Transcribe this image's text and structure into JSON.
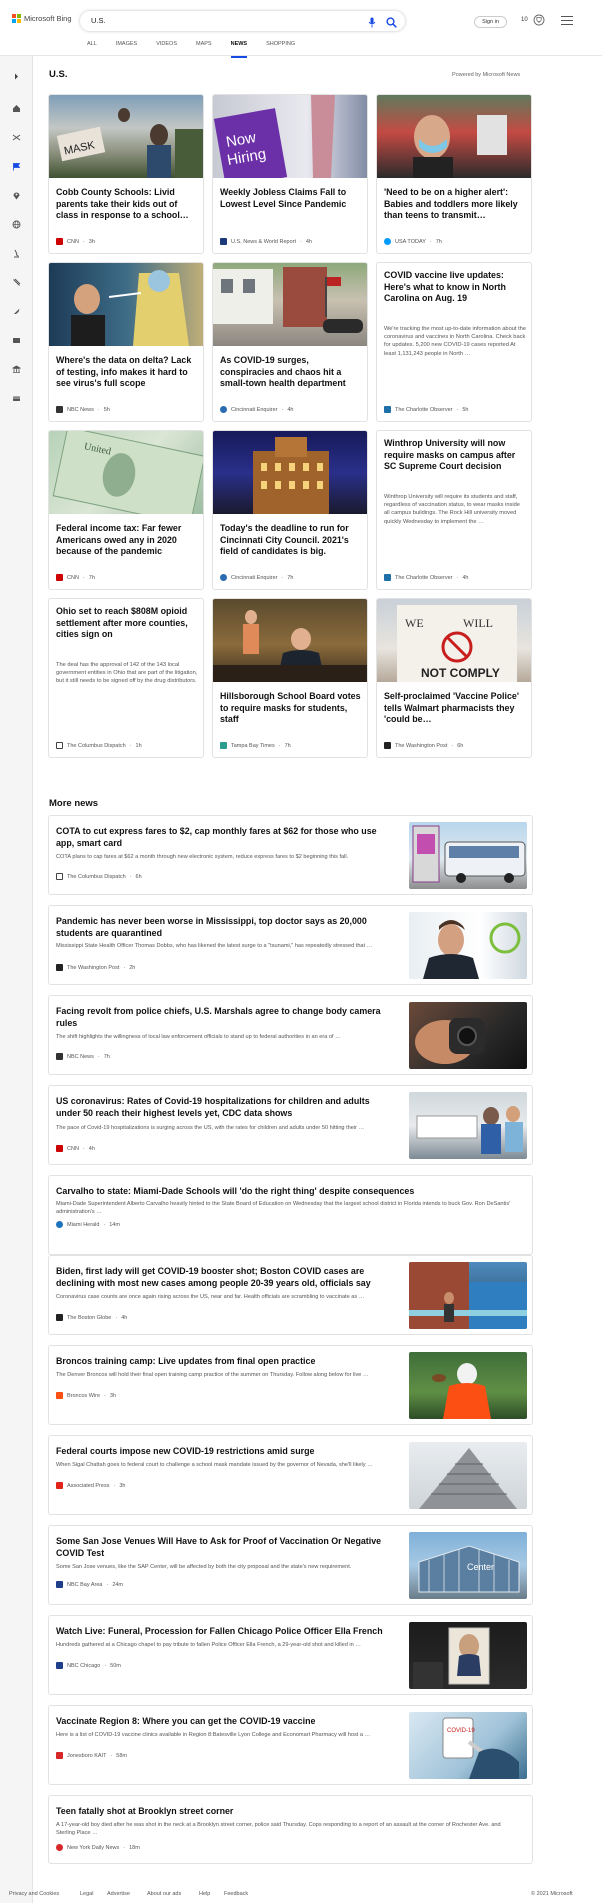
{
  "brand": {
    "name": "Microsoft Bing",
    "colors": [
      "#f25022",
      "#7fba00",
      "#00a4ef",
      "#ffb900"
    ]
  },
  "search": {
    "query": "U.S.",
    "mic_icon": "microphone-icon",
    "search_icon": "search-icon"
  },
  "header": {
    "signin": "Sign in",
    "rewards": "10"
  },
  "tabs": [
    {
      "label": "ALL"
    },
    {
      "label": "IMAGES"
    },
    {
      "label": "VIDEOS"
    },
    {
      "label": "MAPS"
    },
    {
      "label": "NEWS"
    },
    {
      "label": "SHOPPING"
    }
  ],
  "active_tab": "NEWS",
  "section": {
    "title": "U.S.",
    "powered": "Powered by Microsoft News"
  },
  "cards": [
    {
      "title": "Cobb County Schools: Livid parents take their kids out of class in response to a school…",
      "source": "CNN",
      "time": "3h",
      "src_color": "#cc0000"
    },
    {
      "title": "Weekly Jobless Claims Fall to Lowest Level Since Pandemic",
      "source": "U.S. News & World Report",
      "time": "4h",
      "src_color": "#1a3a7a"
    },
    {
      "title": "'Need to be on a higher alert': Babies and toddlers more likely than teens to transmit…",
      "source": "USA TODAY",
      "time": "7h",
      "src_color": "#009bff"
    },
    {
      "title": "Where's the data on delta? Lack of testing, info makes it hard to see virus's full scope",
      "source": "NBC News",
      "time": "5h",
      "src_color": "#333333"
    },
    {
      "title": "As COVID-19 surges, conspiracies and chaos hit a small-town health department",
      "source": "Cincinnati Enquirer",
      "time": "4h",
      "src_color": "#2b6cb0"
    },
    {
      "title": "COVID vaccine live updates: Here's what to know in North Carolina on Aug. 19",
      "snippet": "We're tracking the most up-to-date information about the coronavirus and vaccines in North Carolina. Check back for updates. 5,200 new COVID-19 cases reported At least 1,131,243 people in North …",
      "source": "The Charlotte Observer",
      "time": "5h",
      "src_color": "#1f6fa8"
    },
    {
      "title": "Federal income tax: Far fewer Americans owed any in 2020 because of the pandemic",
      "source": "CNN",
      "time": "7h",
      "src_color": "#cc0000"
    },
    {
      "title": "Today's the deadline to run for Cincinnati City Council. 2021's field of candidates is big.",
      "source": "Cincinnati Enquirer",
      "time": "7h",
      "src_color": "#2b6cb0"
    },
    {
      "title": "Winthrop University will now require masks on campus after SC Supreme Court decision",
      "snippet": "Winthrop University will require its students and staff, regardless of vaccination status, to wear masks inside all campus buildings. The Rock Hill university moved quickly Wednesday to implement the …",
      "source": "The Charlotte Observer",
      "time": "4h",
      "src_color": "#1f6fa8"
    },
    {
      "title": "Ohio set to reach $808M opioid settlement after more counties, cities sign on",
      "snippet": "The deal has the approval of 142 of the 143 local government entities in Ohio that are part of the litigation, but it still needs to be signed off by the drug distributors.",
      "source": "The Columbus Dispatch",
      "time": "1h",
      "src_color": "#444444"
    },
    {
      "title": "Hillsborough School Board votes to require masks for students, staff",
      "source": "Tampa Bay Times",
      "time": "7h",
      "src_color": "#2a9d8f"
    },
    {
      "title": "Self-proclaimed 'Vaccine Police' tells Walmart pharmacists they 'could be…",
      "source": "The Washington Post",
      "time": "6h",
      "src_color": "#222222"
    }
  ],
  "more": {
    "title": "More news"
  },
  "rows": [
    {
      "title": "COTA to cut express fares to $2, cap monthly fares at $62 for those who use app, smart card",
      "snippet": "COTA plans to cap fares at $62 a month through new electronic system, reduce express fares to $2 beginning this fall.",
      "source": "The Columbus Dispatch",
      "time": "6h",
      "src_color": "#444444"
    },
    {
      "title": "Pandemic has never been worse in Mississippi, top doctor says as 20,000 students are quarantined",
      "snippet": "Mississippi State Health Officer Thomas Dobbs, who has likened the latest surge to a \"tsunami,\" has repeatedly stressed that …",
      "source": "The Washington Post",
      "time": "2h",
      "src_color": "#222222"
    },
    {
      "title": "Facing revolt from police chiefs, U.S. Marshals agree to change body camera rules",
      "snippet": "The shift highlights the willingness of local law enforcement officials to stand up to federal authorities in an era of …",
      "source": "NBC News",
      "time": "7h",
      "src_color": "#333333"
    },
    {
      "title": "US coronavirus: Rates of Covid-19 hospitalizations for children and adults under 50 reach their highest levels yet, CDC data shows",
      "snippet": "The pace of Covid-19 hospitalizations is surging across the US, with the rates for children and adults under 50 hitting their …",
      "source": "CNN",
      "time": "4h",
      "src_color": "#cc0000"
    },
    {
      "title": "Carvalho to state: Miami-Dade Schools will 'do the right thing' despite consequences",
      "snippet": "Miami-Dade Superintendent Alberto Carvalho heavily hinted to the State Board of Education on Wednesday that the largest school district in Florida intends to buck Gov. Ron DeSantis' administration's …",
      "source": "Miami Herald",
      "time": "14m",
      "src_color": "#1e73be"
    },
    {
      "title": "Biden, first lady will get COVID-19 booster shot; Boston COVID cases are declining with most new cases among people 20-39 years old, officials say",
      "snippet": "Coronavirus case counts are once again rising across the US, near and far. Health officials are scrambling to vaccinate as …",
      "source": "The Boston Globe",
      "time": "4h",
      "src_color": "#222222"
    },
    {
      "title": "Broncos training camp: Live updates from final open practice",
      "snippet": "The Denver Broncos will hold their final open training camp practice of the summer on Thursday. Follow along below for live …",
      "source": "Broncos Wire",
      "time": "3h",
      "src_color": "#fb4f14"
    },
    {
      "title": "Federal courts impose new COVID-19 restrictions amid surge",
      "snippet": "When Sigal Chattah goes to federal court to challenge a school mask mandate issued by the governor of Nevada, she'll likely …",
      "source": "Associated Press",
      "time": "3h",
      "src_color": "#e2231a"
    },
    {
      "title": "Some San Jose Venues Will Have to Ask for Proof of Vaccination Or Negative COVID Test",
      "snippet": "Some San Jose venues, like the SAP Center, will be affected by both the city proposal and the state's new requirement.",
      "source": "NBC Bay Area",
      "time": "24m",
      "src_color": "#1d3f8a"
    },
    {
      "title": "Watch Live: Funeral, Procession for Fallen Chicago Police Officer Ella French",
      "snippet": "Hundreds gathered at a Chicago chapel to pay tribute to fallen Police Officer Ella French, a 29-year-old shot and killed in …",
      "source": "NBC Chicago",
      "time": "50m",
      "src_color": "#1d3f8a"
    },
    {
      "title": "Vaccinate Region 8: Where you can get the COVID-19 vaccine",
      "snippet": "Here is a list of COVID-19 vaccine clinics available in Region 8:Batesville Lyon College and Economart Pharmacy will host a …",
      "source": "Jonesboro KAIT",
      "time": "58m",
      "src_color": "#d62828"
    },
    {
      "title": "Teen fatally shot at Brooklyn street corner",
      "snippet": "A 17-year-old boy died after he was shot in the neck at a Brooklyn street corner, police said Thursday. Cops responding to a report of an assault at the corner of Rochester Ave. and Sterling Place …",
      "source": "New York Daily News",
      "time": "18m",
      "src_color": "#d62828"
    }
  ],
  "rail_icons": [
    "chevron-right-icon",
    "home-icon",
    "shuffle-icon",
    "flag-icon",
    "location-pin-icon",
    "globe-icon",
    "microscope-icon",
    "film-icon",
    "rocket-icon",
    "tv-icon",
    "bank-icon",
    "wallet-icon"
  ],
  "footer": {
    "links": [
      "Privacy and Cookies",
      "Legal",
      "Advertise",
      "About our ads",
      "Help",
      "Feedback"
    ],
    "copyright": "© 2021 Microsoft"
  }
}
